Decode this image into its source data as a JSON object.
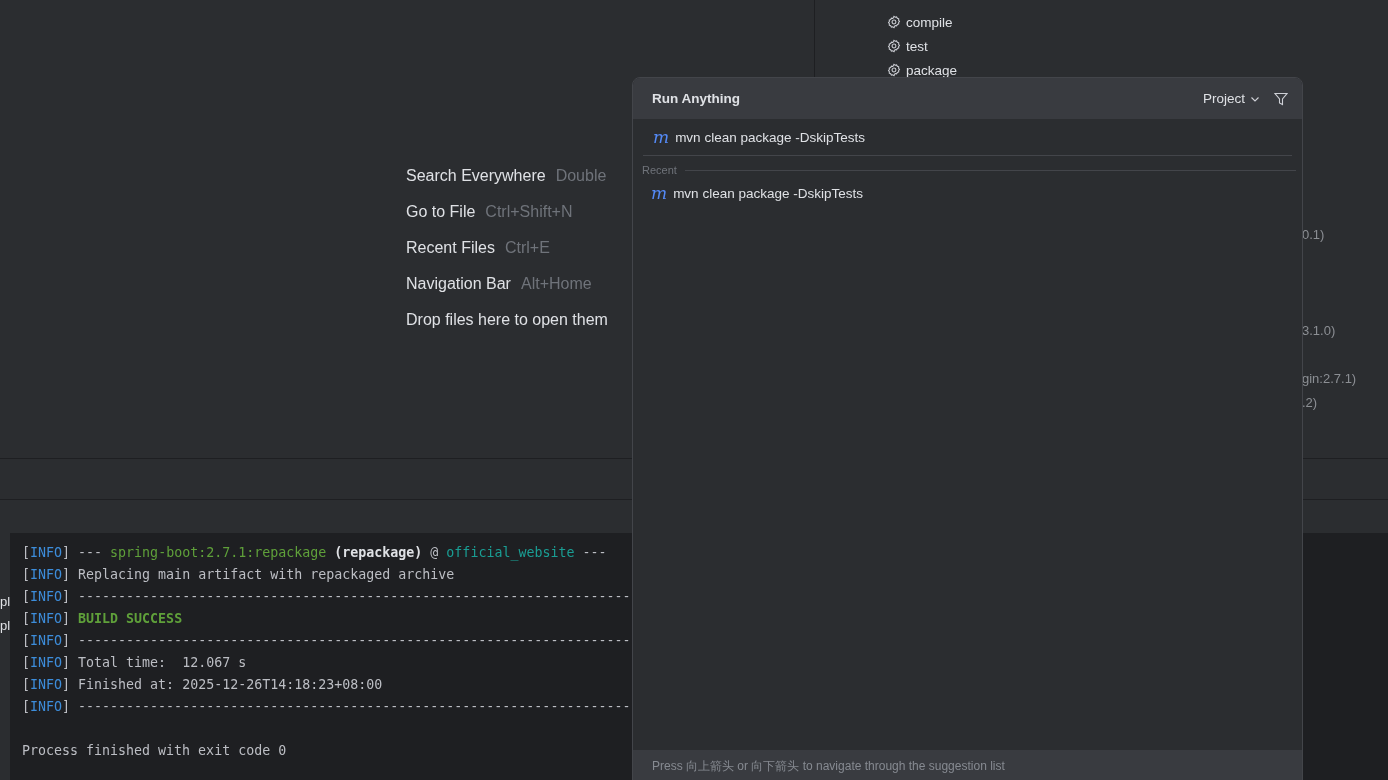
{
  "maven_tasks": [
    {
      "label": "compile"
    },
    {
      "label": "test"
    },
    {
      "label": "package"
    }
  ],
  "maven_fragments": [
    "0.1)",
    "3.1.0)",
    "gin:2.7.1)",
    ".2)"
  ],
  "welcome_hints": [
    {
      "action": "Search Everywhere",
      "shortcut": "Double"
    },
    {
      "action": "Go to File",
      "shortcut": "Ctrl+Shift+N"
    },
    {
      "action": "Recent Files",
      "shortcut": "Ctrl+E"
    },
    {
      "action": "Navigation Bar",
      "shortcut": "Alt+Home"
    },
    {
      "action": "Drop files here to open them"
    }
  ],
  "left_gutter": [
    "pl",
    "pl"
  ],
  "console": {
    "lines": [
      {
        "segments": [
          {
            "kind": "plain",
            "text": "["
          },
          {
            "kind": "info",
            "text": "INFO"
          },
          {
            "kind": "plain",
            "text": "] --- "
          },
          {
            "kind": "green",
            "text": "spring-boot:2.7.1:repackage"
          },
          {
            "kind": "bold",
            "text": " (repackage)"
          },
          {
            "kind": "plain",
            "text": " @ "
          },
          {
            "kind": "teal",
            "text": "official_website"
          },
          {
            "kind": "plain",
            "text": " ---"
          }
        ]
      },
      {
        "segments": [
          {
            "kind": "plain",
            "text": "["
          },
          {
            "kind": "info",
            "text": "INFO"
          },
          {
            "kind": "plain",
            "text": "] Replacing main artifact with repackaged archive"
          }
        ]
      },
      {
        "segments": [
          {
            "kind": "plain",
            "text": "["
          },
          {
            "kind": "info",
            "text": "INFO"
          },
          {
            "kind": "plain",
            "text": "] ---------------------------------------------------------------------"
          }
        ]
      },
      {
        "segments": [
          {
            "kind": "plain",
            "text": "["
          },
          {
            "kind": "info",
            "text": "INFO"
          },
          {
            "kind": "plain",
            "text": "] "
          },
          {
            "kind": "success",
            "text": "BUILD SUCCESS"
          }
        ]
      },
      {
        "segments": [
          {
            "kind": "plain",
            "text": "["
          },
          {
            "kind": "info",
            "text": "INFO"
          },
          {
            "kind": "plain",
            "text": "] ---------------------------------------------------------------------"
          }
        ]
      },
      {
        "segments": [
          {
            "kind": "plain",
            "text": "["
          },
          {
            "kind": "info",
            "text": "INFO"
          },
          {
            "kind": "plain",
            "text": "] Total time:  12.067 s"
          }
        ]
      },
      {
        "segments": [
          {
            "kind": "plain",
            "text": "["
          },
          {
            "kind": "info",
            "text": "INFO"
          },
          {
            "kind": "plain",
            "text": "] Finished at: 2025-12-26T14:18:23+08:00"
          }
        ]
      },
      {
        "segments": [
          {
            "kind": "plain",
            "text": "["
          },
          {
            "kind": "info",
            "text": "INFO"
          },
          {
            "kind": "plain",
            "text": "] ---------------------------------------------------------------------"
          }
        ]
      },
      {
        "kind": "summary",
        "segments": [
          {
            "kind": "plain",
            "text": "Process finished with exit code 0"
          }
        ]
      }
    ]
  },
  "run_anything": {
    "title": "Run Anything",
    "scope": "Project",
    "input": {
      "icon": "m",
      "value": "mvn clean package -DskipTests"
    },
    "section": "Recent",
    "items": [
      {
        "icon": "m",
        "label": "mvn clean package -DskipTests"
      }
    ],
    "footer": "Press 向上箭头 or 向下箭头 to navigate through the suggestion list"
  }
}
